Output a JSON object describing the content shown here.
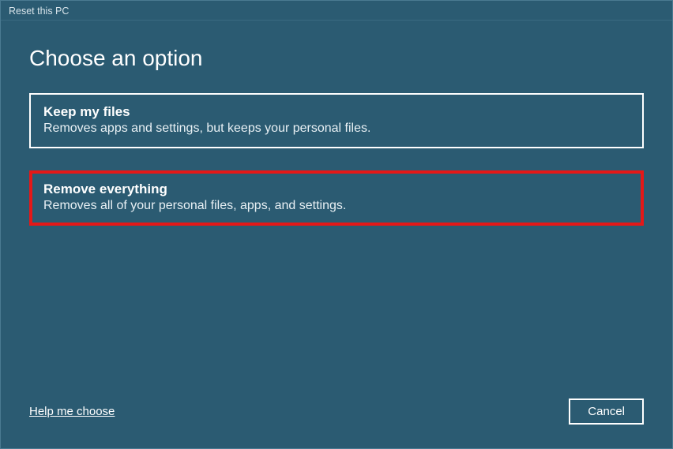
{
  "window": {
    "title": "Reset this PC"
  },
  "page": {
    "title": "Choose an option"
  },
  "options": {
    "keep_files": {
      "title": "Keep my files",
      "desc": "Removes apps and settings, but keeps your personal files."
    },
    "remove_everything": {
      "title": "Remove everything",
      "desc": "Removes all of your personal files, apps, and settings."
    }
  },
  "footer": {
    "help_link": "Help me choose",
    "cancel_label": "Cancel"
  },
  "colors": {
    "background": "#2b5b72",
    "highlight_border": "#e51818",
    "normal_border": "#ffffff"
  }
}
